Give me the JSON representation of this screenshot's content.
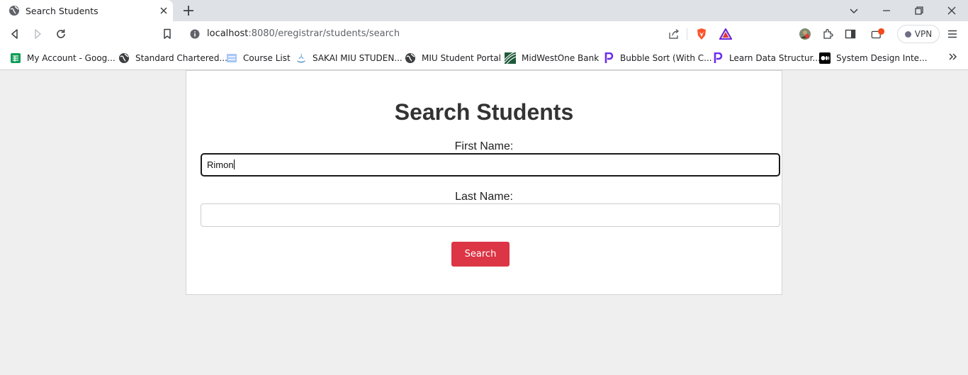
{
  "browser": {
    "tab": {
      "title": "Search Students"
    },
    "address": {
      "host": "localhost",
      "rest": ":8080/eregistrar/students/search"
    },
    "vpn_label": "VPN",
    "bookmarks": [
      {
        "label": "My Account - Goog...",
        "icon": "sheets-icon"
      },
      {
        "label": "Standard Chartered...",
        "icon": "globe-icon"
      },
      {
        "label": "Course List",
        "icon": "page-icon"
      },
      {
        "label": "SAKAI MIU STUDEN...",
        "icon": "sakai-icon"
      },
      {
        "label": "MIU Student Portal",
        "icon": "globe-icon"
      },
      {
        "label": "MidWestOne Bank",
        "icon": "bank-icon"
      },
      {
        "label": "Bubble Sort (With C...",
        "icon": "p-icon"
      },
      {
        "label": "Learn Data Structur...",
        "icon": "p-icon"
      },
      {
        "label": "System Design Inte...",
        "icon": "medium-icon"
      }
    ]
  },
  "page": {
    "heading": "Search Students",
    "first_name_label": "First Name:",
    "first_name_value": "Rimon",
    "last_name_label": "Last Name:",
    "last_name_value": "",
    "search_button": "Search"
  },
  "colors": {
    "primary_button": "#dc3545",
    "page_background": "#efefef"
  }
}
